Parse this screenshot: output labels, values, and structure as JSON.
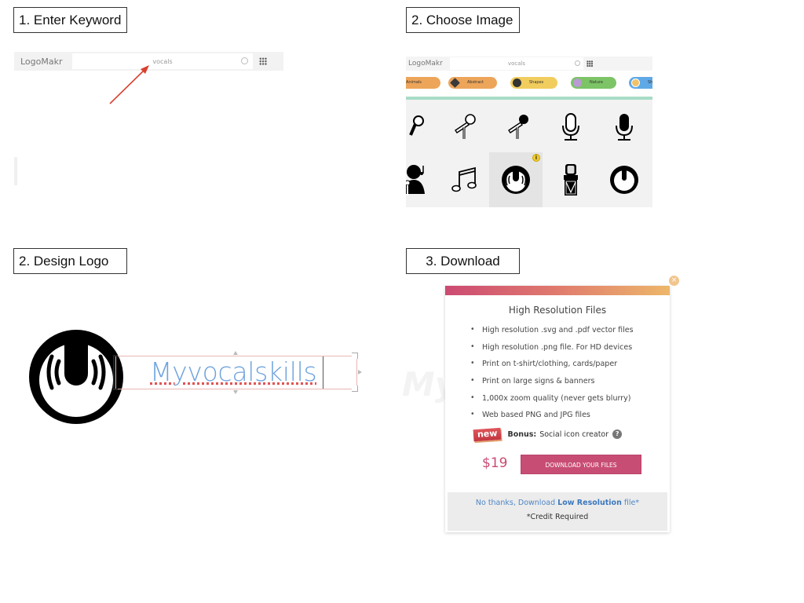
{
  "steps": [
    {
      "label": "1. Enter Keyword"
    },
    {
      "label": "2. Choose Image"
    },
    {
      "label": "2. Design Logo"
    },
    {
      "label": "3. Download"
    }
  ],
  "enter_keyword": {
    "app_logo": "LogoMakr",
    "search_value": "vocals",
    "annotation_arrow_color": "#d9412f"
  },
  "choose_image": {
    "app_logo": "LogoMakr",
    "search_value": "vocals",
    "categories": [
      {
        "label": "Animals",
        "color": "#eda55a"
      },
      {
        "label": "Abstract",
        "color": "#eda55a"
      },
      {
        "label": "Shapes",
        "color": "#f1cd5e"
      },
      {
        "label": "Nature",
        "color": "#7cc466"
      },
      {
        "label": "Sh",
        "color": "#5fa9e6"
      }
    ],
    "icons": [
      {
        "name": "handheld-mic-partial"
      },
      {
        "name": "stand-mic-outline"
      },
      {
        "name": "stand-mic-filled-head"
      },
      {
        "name": "studio-mic-outline"
      },
      {
        "name": "studio-mic-filled"
      },
      {
        "name": "singer-with-mic-partial"
      },
      {
        "name": "music-notes"
      },
      {
        "name": "vocal-waves-circle",
        "selected": true,
        "info_badge": "i"
      },
      {
        "name": "vintage-mic"
      },
      {
        "name": "power-circle"
      }
    ]
  },
  "design_logo": {
    "logo_text": "Myvocalskills",
    "text_color": "#6fa3de",
    "ghost_text": "My"
  },
  "download": {
    "close_icon": "×",
    "title": "High Resolution Files",
    "features": [
      "High resolution .svg and .pdf vector files",
      "High resolution .png file. For HD devices",
      "Print on t-shirt/clothing, cards/paper",
      "Print on large signs & banners",
      "1,000x zoom quality (never gets blurry)",
      "Web based PNG and JPG files"
    ],
    "new_badge": "new",
    "bonus_label": "Bonus:",
    "bonus_text": "Social icon creator",
    "help_icon": "?",
    "price": "$19",
    "download_button": "DOWNLOAD YOUR FILES",
    "low_res_prefix": "No thanks, Download ",
    "low_res_bold": "Low Resolution",
    "low_res_suffix": " file*",
    "credit_note": "*Credit Required",
    "accent_color": "#c84d74"
  }
}
